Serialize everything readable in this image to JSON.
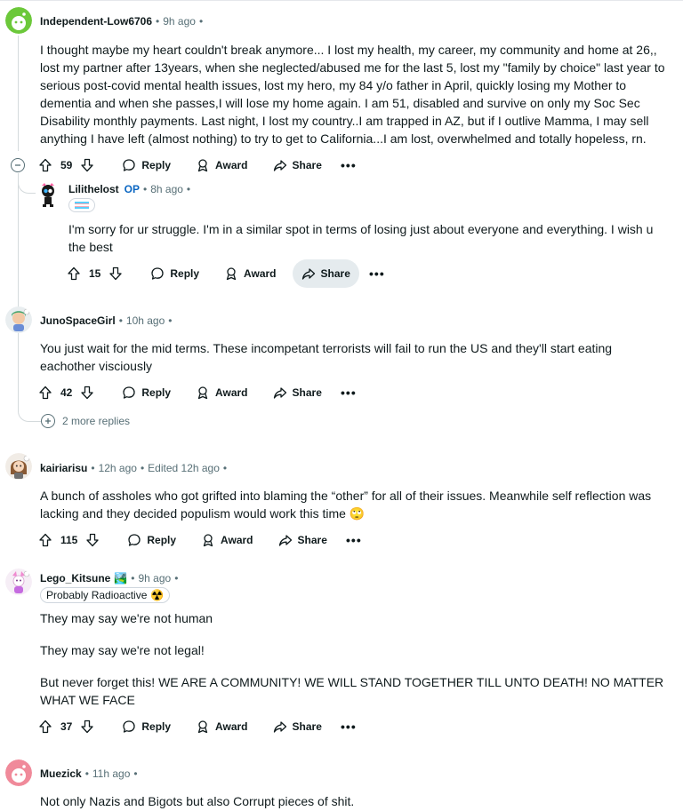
{
  "comments": [
    {
      "author": "Independent-Low6706",
      "time": "9h ago",
      "body": [
        "I thought maybe my heart couldn't break anymore... I lost my health, my career, my community and home at 26,, lost my partner after 13years, when she neglected/abused me for the last 5, lost my \"family by choice\" last year to serious post-covid mental health issues, lost my hero, my 84 y/o father in April, quickly losing my Mother to dementia and when she passes,I will lose my home again. I am 51, disabled and survive on only my Soc Sec Disability monthly payments. Last night, I lost my country..I am trapped in AZ, but if I outlive Mamma, I may sell anything I have left (almost nothing) to try to get to California...I am lost, overwhelmed and totally hopeless, rn."
      ],
      "votes": "59"
    },
    {
      "author": "Lilithelost",
      "op_label": "OP",
      "time": "8h ago",
      "body": [
        "I'm sorry for ur struggle. I'm in a similar spot in terms of losing just about everyone and everything. I wish u the best"
      ],
      "votes": "15"
    },
    {
      "author": "JunoSpaceGirl",
      "time": "10h ago",
      "body": [
        "You just wait for the mid terms. These incompetant terrorists will fail to run the US and they'll start eating eachother visciously"
      ],
      "votes": "42"
    },
    {
      "author": "kairiarisu",
      "time": "12h ago",
      "edited": "Edited 12h ago",
      "body": [
        "A bunch of assholes who got grifted into blaming the “other” for all of their issues. Meanwhile self reflection was lacking and they decided populism would work this time 🙄"
      ],
      "votes": "115"
    },
    {
      "author": "Lego_Kitsune",
      "author_emoji": "🏞️",
      "time": "9h ago",
      "flair": "Probably Radioactive",
      "flair_emoji": "☢️",
      "body": [
        "They may say we're not human",
        "They may say we're not legal!",
        "But never forget this! WE ARE A COMMUNITY! WE WILL STAND TOGETHER TILL UNTO DEATH! NO MATTER WHAT WE FACE"
      ],
      "votes": "37"
    },
    {
      "author": "Muezick",
      "time": "11h ago",
      "body": [
        "Not only Nazis and Bigots but also Corrupt pieces of shit."
      ]
    }
  ],
  "actions": {
    "reply": "Reply",
    "award": "Award",
    "share": "Share",
    "more": "•••"
  },
  "dot": "•",
  "more_replies": "2 more replies",
  "icons": {
    "upvote": "upvote-icon",
    "downvote": "downvote-icon",
    "reply": "speech-bubble-icon",
    "award": "award-icon",
    "share": "share-arrow-icon",
    "collapse": "collapse-minus-icon",
    "expand": "expand-plus-icon"
  },
  "colors": {
    "accent": "#0a66c2",
    "muted": "#576f76",
    "text": "#0f1a1c",
    "thread": "#d4dadc",
    "active_bg": "#e5ebee"
  }
}
